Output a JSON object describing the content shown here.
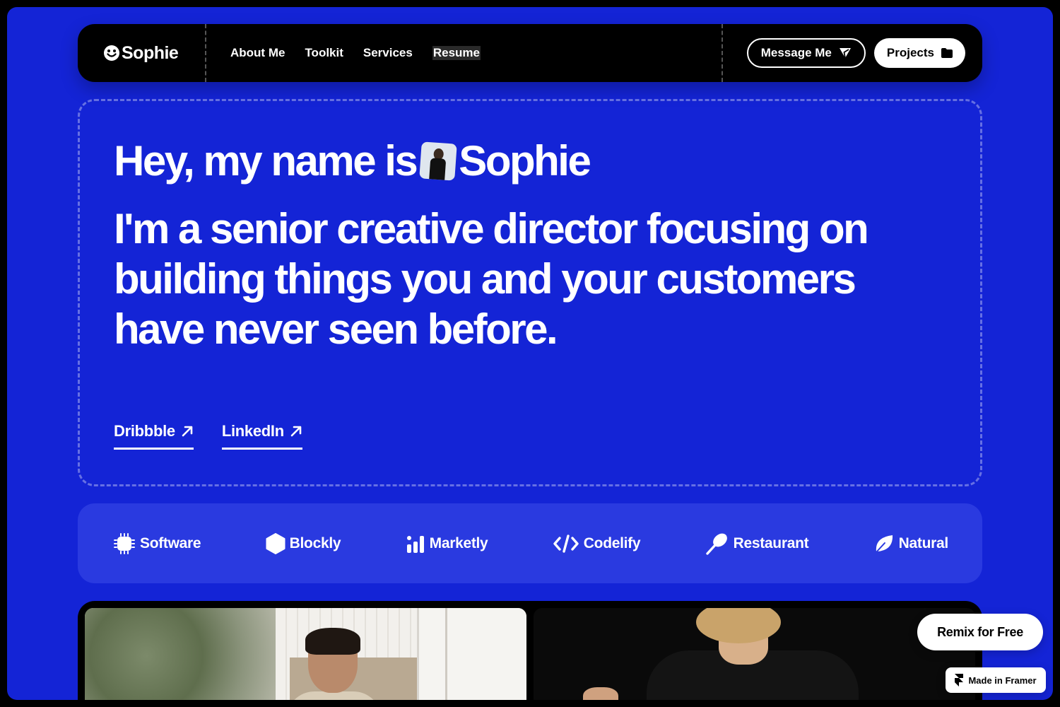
{
  "nav": {
    "logo": "Sophie",
    "links": [
      "About Me",
      "Toolkit",
      "Services",
      "Resume"
    ],
    "message_label": "Message Me",
    "projects_label": "Projects"
  },
  "hero": {
    "greeting_prefix": "Hey, my name is",
    "greeting_name": "Sophie",
    "subtitle": "I'm a senior creative director focusing on building things you and your customers have never seen before.",
    "links": [
      "Dribbble",
      "LinkedIn"
    ]
  },
  "brands": [
    "Software",
    "Blockly",
    "Marketly",
    "Codelify",
    "Restaurant",
    "Natural"
  ],
  "badges": {
    "remix": "Remix for Free",
    "framer": "Made in Framer"
  },
  "colors": {
    "background": "#1424d6",
    "brand_bar": "#2a3ae0",
    "nav": "#000000",
    "text": "#ffffff"
  }
}
